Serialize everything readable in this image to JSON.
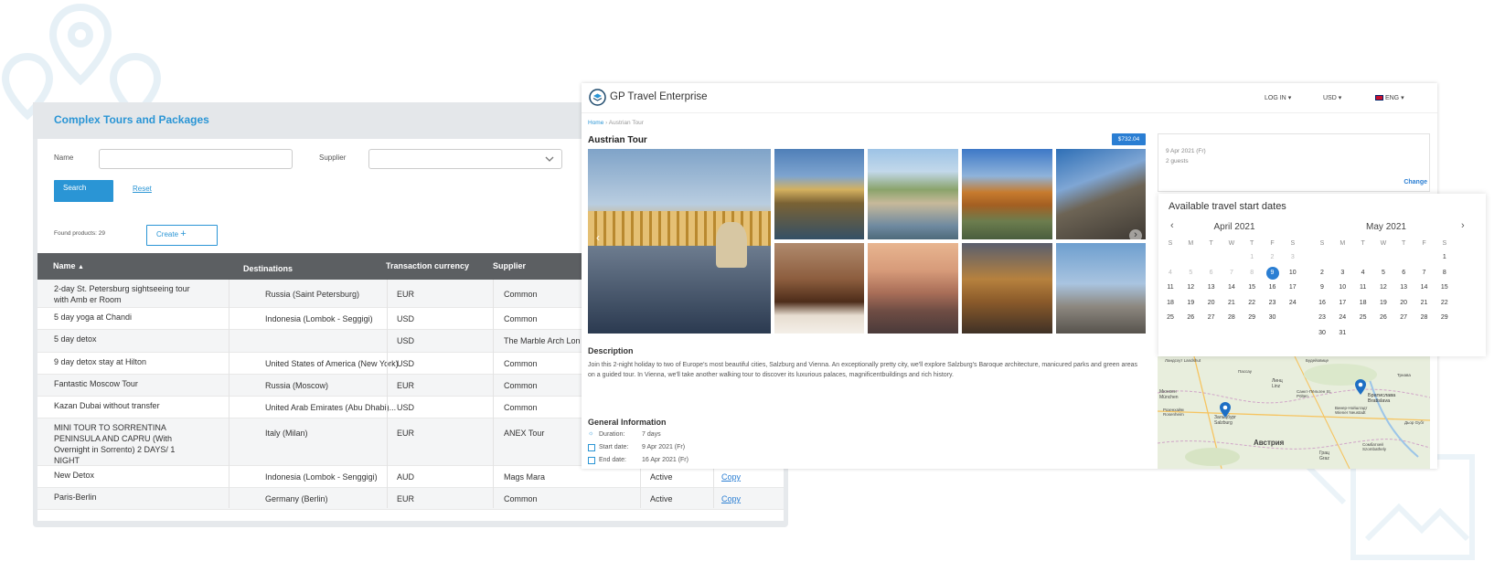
{
  "left_panel": {
    "title": "Complex Tours and Packages",
    "name_label": "Name",
    "supplier_label": "Supplier",
    "search_button": "Search",
    "reset_link": "Reset",
    "found_products": "Found products: 29",
    "create_button": "Create",
    "columns": [
      "Name",
      "Destinations",
      "Transaction currency",
      "Supplier"
    ],
    "rows": [
      {
        "name": "2-day St. Petersburg sightseeing tour with Amb er Room",
        "dest": "Russia (Saint Petersburg)",
        "cur": "EUR",
        "supplier": "Common",
        "status": "",
        "copy": ""
      },
      {
        "name": "5 day yoga at Chandi",
        "dest": "Indonesia (Lombok - Seggigi)",
        "cur": "USD",
        "supplier": "Common",
        "status": "",
        "copy": ""
      },
      {
        "name": "5 day detox",
        "dest": "",
        "cur": "USD",
        "supplier": "The Marble Arch Lon",
        "status": "",
        "copy": ""
      },
      {
        "name": "9 day detox stay at Hilton",
        "dest": "United States of America (New York)",
        "cur": "USD",
        "supplier": "Common",
        "status": "",
        "copy": ""
      },
      {
        "name": "Fantastic Moscow Tour",
        "dest": "Russia (Moscow)",
        "cur": "EUR",
        "supplier": "Common",
        "status": "",
        "copy": ""
      },
      {
        "name": "Kazan Dubai without transfer",
        "dest": "United Arab Emirates (Abu Dhabi)...",
        "cur": "USD",
        "supplier": "Common",
        "status": "",
        "copy": ""
      },
      {
        "name": "MINI TOUR TO SORRENTINA PENINSULA AND CAPRU (With Overnight in Sorrento) 2 DAYS/ 1 NIGHT",
        "dest": "Italy (Milan)",
        "cur": "EUR",
        "supplier": "ANEX Tour",
        "status": "",
        "copy": ""
      },
      {
        "name": "New Detox",
        "dest": "Indonesia (Lombok  - Senggigi)",
        "cur": "AUD",
        "supplier": "Mags Mara",
        "status": "Active",
        "copy": "Copy"
      },
      {
        "name": "Paris-Berlin",
        "dest": "Germany (Berlin)",
        "cur": "EUR",
        "supplier": "Common",
        "status": "Active",
        "copy": "Copy"
      }
    ]
  },
  "right_panel": {
    "brand": "GP Travel Enterprise",
    "menu": {
      "login": "LOG IN",
      "currency": "USD",
      "language": "ENG"
    },
    "breadcrumb": {
      "home": "Home",
      "current": "Austrian Tour"
    },
    "tour_title": "Austrian Tour",
    "price": "$732.04",
    "description_title": "Description",
    "description": "Join this 2-night holiday to two of Europe's most beautiful cities, Salzburg and Vienna. An exceptionally pretty city, we'll explore Salzburg's Baroque architecture, manicured parks and green areas on a guided tour. In Vienna, we'll take another walking tour to discover its luxurious palaces, magnificentbuildings and rich history.",
    "general_title": "General Information",
    "general": [
      {
        "label": "Duration:",
        "value": "7 days"
      },
      {
        "label": "Start date:",
        "value": "9 Apr 2021 (Fr)"
      },
      {
        "label": "End date:",
        "value": "16 Apr 2021 (Fr)"
      }
    ],
    "booking": {
      "date": "9 Apr 2021 (Fr)",
      "guests": "2 guests",
      "change": "Change"
    },
    "calendar": {
      "title": "Available travel start dates",
      "dow": [
        "S",
        "M",
        "T",
        "W",
        "T",
        "F",
        "S"
      ],
      "months": [
        {
          "title": "April 2021",
          "offset": 4,
          "days": 30,
          "past_until": 8,
          "selected": 9
        },
        {
          "title": "May 2021",
          "offset": 6,
          "days": 31,
          "past_until": 0,
          "selected": 0
        }
      ]
    },
    "map_labels": {
      "country": "Австрия",
      "salzburg": "Зальцбург Salzburg",
      "bratislava": "Братислава Bratislava",
      "linz": "Линц Linz",
      "munich": "Мюнхен München",
      "rosenheim": "Розенхайм Rosenheim",
      "graz": "Грац Graz",
      "sopron": "Сомбатхей Szombathely",
      "wiener": "Винер-Нойштадт Wiener Neustadt",
      "passau": "Пассау",
      "dyor": "Дьор Győr",
      "budweis": "Будейовице",
      "landshut": "Ландсхут Landshut",
      "st_poelten": "Санкт-Пёльтен St. Pölten",
      "trnava": "Трнава"
    }
  }
}
